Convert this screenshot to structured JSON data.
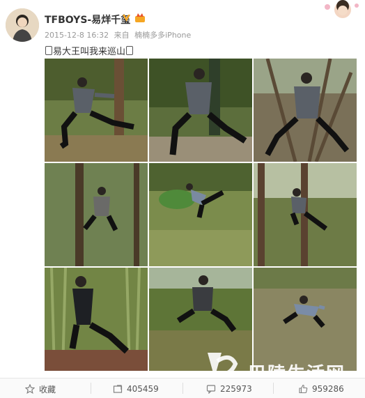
{
  "user": {
    "name": "TFBOYS-易烊千玺"
  },
  "meta": {
    "datetime": "2015-12-8 16:32",
    "source_prefix": "来自",
    "source": "楠楠多多iPhone"
  },
  "post": {
    "text": "易大王叫我来巡山"
  },
  "images": [
    {
      "bg": "#6c7d45"
    },
    {
      "bg": "#5c6e3c"
    },
    {
      "bg": "#7a7058"
    },
    {
      "bg": "#5f7040"
    },
    {
      "bg": "#7b8c4c"
    },
    {
      "bg": "#6d7b46"
    },
    {
      "bg": "#728545"
    },
    {
      "bg": "#5e7537"
    },
    {
      "bg": "#8a8662"
    }
  ],
  "actions": {
    "favorite_label": "收藏",
    "repost_count": "405459",
    "comment_count": "225973",
    "like_count": "959286"
  },
  "watermark": {
    "text": "巴陵生活网"
  },
  "colors": {
    "verified": "#f5a623",
    "text": "#333333",
    "muted": "#999999"
  }
}
